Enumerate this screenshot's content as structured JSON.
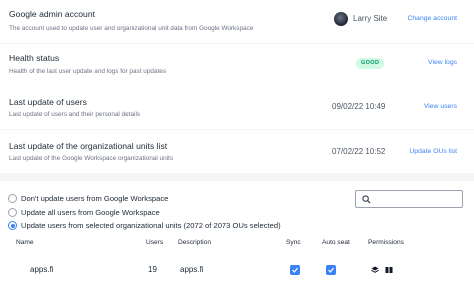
{
  "google_account": {
    "title": "Google admin account",
    "description": "The account used to update user and organizational unit data from Google Workspace",
    "user_name": "Larry Site",
    "action": "Change account"
  },
  "health": {
    "title": "Health status",
    "description": "Health of the last user update and logs for past updates",
    "status": "GOOD",
    "action": "View logs"
  },
  "last_users": {
    "title": "Last update of users",
    "description": "Last update of users and their personal details",
    "timestamp": "09/02/22 10:49",
    "action": "View users"
  },
  "last_ous": {
    "title": "Last update of the organizational units list",
    "description": "Last update of the Google Workspace organizational units",
    "timestamp": "07/02/22 10:52",
    "action": "Update OUs list"
  },
  "update_options": [
    {
      "label": "Don't update users from Google Workspace",
      "selected": false
    },
    {
      "label": "Update all users from Google Workspace",
      "selected": false
    },
    {
      "label": "Update users from selected organizational units (2072 of 2073 OUs selected)",
      "selected": true
    }
  ],
  "search": {
    "placeholder": ""
  },
  "table": {
    "headers": {
      "name": "Name",
      "users": "Users",
      "description": "Description",
      "sync": "Sync",
      "auto_seat": "Auto seat",
      "permissions": "Permissions"
    },
    "rows": [
      {
        "name": "apps.fi",
        "users": "19",
        "description": "apps.fi",
        "sync": true,
        "auto_seat": true
      }
    ]
  },
  "colors": {
    "accent": "#3b82f6",
    "good_bg": "#d1fae5",
    "good_text": "#059669"
  }
}
